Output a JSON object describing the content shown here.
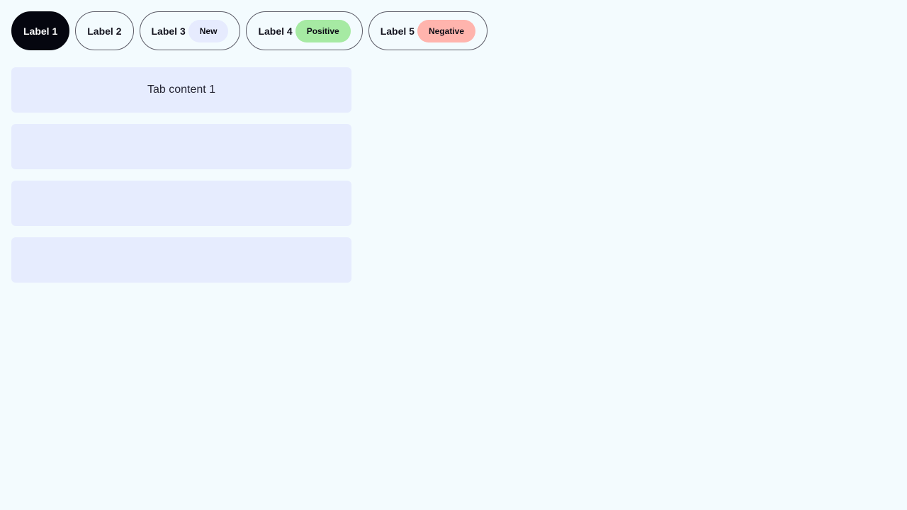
{
  "tabs": [
    {
      "label": "Label 1",
      "active": true,
      "badge": null
    },
    {
      "label": "Label 2",
      "active": false,
      "badge": null
    },
    {
      "label": "Label 3",
      "active": false,
      "badge": {
        "text": "New",
        "kind": "new"
      }
    },
    {
      "label": "Label 4",
      "active": false,
      "badge": {
        "text": "Positive",
        "kind": "positive"
      }
    },
    {
      "label": "Label 5",
      "active": false,
      "badge": {
        "text": "Negative",
        "kind": "negative"
      }
    }
  ],
  "panels": [
    {
      "content": "Tab content 1"
    },
    {
      "content": ""
    },
    {
      "content": ""
    },
    {
      "content": ""
    }
  ],
  "colors": {
    "background": "#f3fbfe",
    "active_tab": "#05060f",
    "panel": "#e6ecfe",
    "badge_new": "#e6ebfe",
    "badge_positive": "#a6eaa3",
    "badge_negative": "#ffb4ad"
  }
}
